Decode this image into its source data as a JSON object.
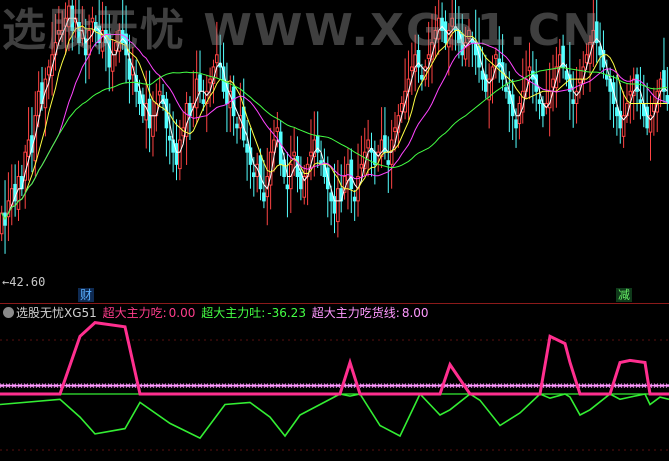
{
  "watermark": "选股无忧 WWW.XG51.CN",
  "price_panel": {
    "low_label": "←42.60",
    "tag_buy": "财",
    "tag_sell": "减"
  },
  "indicator_panel": {
    "name": "选股无忧XG51",
    "items": [
      {
        "label": "超大主力吃:",
        "value": "0.00",
        "color": "#ff3d8b"
      },
      {
        "label": "超大主力吐:",
        "value": "-36.23",
        "color": "#44ff44"
      },
      {
        "label": "超大主力吃货线:",
        "value": "8.00",
        "color": "#ff99ff"
      }
    ]
  },
  "colors": {
    "up": "#ff4444",
    "down": "#54ffff",
    "ma_fast": "#ffffff",
    "ma_mid": "#ffff44",
    "ma_slow": "#ff44ff",
    "ma_long": "#44ff44",
    "line_eat": "#ff2f8f",
    "line_spit": "#33ee33",
    "baseline": "#ff99ff"
  },
  "chart_data": [
    {
      "type": "candlestick",
      "title": "",
      "low_marker": 42.6,
      "ylim": [
        40.5,
        63.5
      ],
      "series": [
        {
          "name": "close",
          "values": [
            46,
            45,
            47,
            48,
            47,
            49,
            48,
            51,
            52,
            51,
            54,
            56,
            55,
            57,
            58,
            59,
            60,
            61,
            61,
            62,
            63,
            61,
            62,
            60,
            61,
            59,
            61,
            62,
            61,
            60,
            61,
            60,
            58,
            59,
            60,
            61,
            60,
            59,
            57,
            58,
            56,
            55,
            54,
            55,
            53,
            54,
            55,
            56,
            55,
            53,
            52,
            51,
            50,
            52,
            53,
            55,
            54,
            55,
            57,
            56,
            55,
            56,
            57,
            58,
            59,
            58,
            56,
            55,
            56,
            54,
            53,
            54,
            52,
            51,
            50,
            49,
            50,
            48,
            47,
            49,
            51,
            52,
            53,
            50,
            49,
            48,
            50,
            51,
            49,
            48,
            49,
            50,
            51,
            52,
            51,
            50,
            49,
            48,
            47,
            46,
            48,
            47,
            49,
            50,
            48,
            47,
            49,
            50,
            51,
            52,
            51,
            50,
            51,
            52,
            51,
            50,
            52,
            53,
            54,
            55,
            56,
            57,
            58,
            59,
            58,
            57,
            58,
            59,
            60,
            61,
            62,
            61,
            60,
            61,
            62,
            61,
            60,
            59,
            60,
            61,
            60,
            59,
            58,
            57,
            56,
            57,
            58,
            59,
            58,
            57,
            56,
            55,
            54,
            53,
            55,
            56,
            57,
            58,
            57,
            56,
            55,
            54,
            55,
            56,
            57,
            58,
            59,
            58,
            57,
            56,
            55,
            56,
            57,
            58,
            59,
            60,
            61,
            60,
            59,
            58,
            57,
            56,
            55,
            54,
            53,
            54,
            55,
            56,
            57,
            56,
            55,
            54,
            53,
            54,
            55,
            56,
            57,
            56,
            55
          ]
        }
      ]
    },
    {
      "type": "line",
      "title": "选股无忧XG51",
      "x": [
        0,
        60,
        80,
        95,
        125,
        140,
        170,
        200,
        225,
        250,
        270,
        285,
        300,
        340,
        350,
        360,
        380,
        400,
        420,
        440,
        450,
        470,
        480,
        500,
        520,
        540,
        550,
        565,
        570,
        580,
        590,
        610,
        620,
        630,
        645,
        650,
        660,
        669
      ],
      "series": [
        {
          "name": "超大主力吃",
          "values": [
            0,
            0,
            55,
            68,
            64,
            0,
            0,
            0,
            0,
            0,
            0,
            0,
            0,
            0,
            30,
            0,
            0,
            0,
            0,
            0,
            28,
            0,
            0,
            0,
            0,
            0,
            55,
            48,
            30,
            0,
            0,
            0,
            30,
            32,
            30,
            0,
            0,
            0
          ]
        },
        {
          "name": "超大主力吐",
          "values": [
            -10,
            -5,
            -22,
            -38,
            -33,
            -8,
            -28,
            -42,
            -10,
            -8,
            -22,
            -40,
            -20,
            0,
            -2,
            0,
            -30,
            -40,
            0,
            -20,
            -15,
            0,
            -6,
            -30,
            -18,
            0,
            -4,
            0,
            -3,
            -20,
            -15,
            0,
            -5,
            -3,
            0,
            -10,
            -3,
            -5
          ]
        },
        {
          "name": "超大主力吃货线",
          "values": [
            8,
            8,
            8,
            8,
            8,
            8,
            8,
            8,
            8,
            8,
            8,
            8,
            8,
            8,
            8,
            8,
            8,
            8,
            8,
            8,
            8,
            8,
            8,
            8,
            8,
            8,
            8,
            8,
            8,
            8,
            8,
            8,
            8,
            8,
            8,
            8,
            8,
            8
          ]
        }
      ]
    }
  ]
}
